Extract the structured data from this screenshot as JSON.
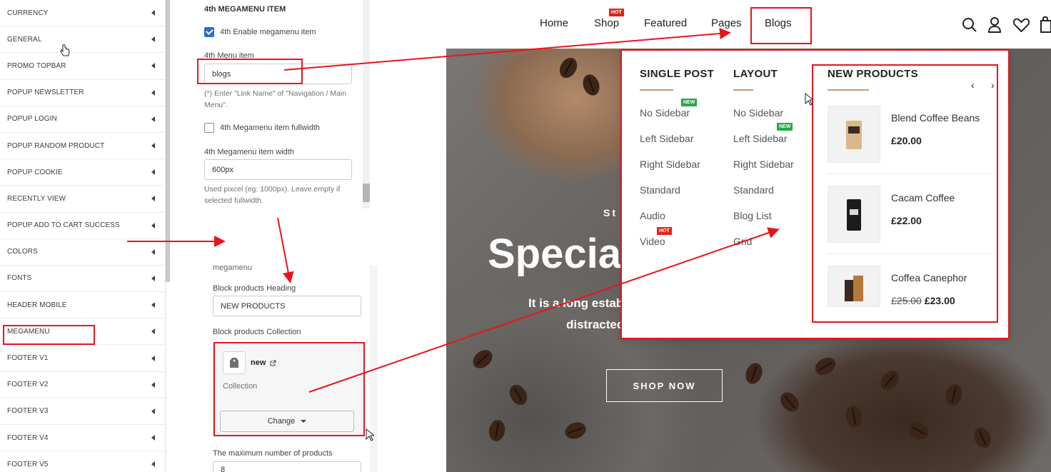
{
  "sidebar": {
    "items": [
      {
        "label": "CURRENCY"
      },
      {
        "label": "GENERAL"
      },
      {
        "label": "PROMO TOPBAR"
      },
      {
        "label": "POPUP NEWSLETTER"
      },
      {
        "label": "POPUP LOGIN"
      },
      {
        "label": "POPUP RANDOM PRODUCT"
      },
      {
        "label": "POPUP COOKIE"
      },
      {
        "label": "RECENTLY VIEW"
      },
      {
        "label": "POPUP ADD TO CART SUCCESS"
      },
      {
        "label": "COLORS"
      },
      {
        "label": "FONTS"
      },
      {
        "label": "HEADER MOBILE"
      },
      {
        "label": "MEGAMENU"
      },
      {
        "label": "FOOTER V1"
      },
      {
        "label": "FOOTER V2"
      },
      {
        "label": "FOOTER V3"
      },
      {
        "label": "FOOTER V4"
      },
      {
        "label": "FOOTER V5"
      }
    ]
  },
  "settings_top": {
    "title": "4th MEGAMENU ITEM",
    "enable_label": "4th Enable megamenu item",
    "enable_checked": true,
    "menu_item_label": "4th Menu item",
    "menu_item_value": "blogs",
    "menu_item_help": "(*) Enter \"Link Name\" of \"Navigation / Main Menu\".",
    "fullwidth_label": "4th Megamenu item fullwidth",
    "fullwidth_checked": false,
    "width_label": "4th Megamenu item width",
    "width_value": "600px",
    "width_help": "Used pixcel (eg: 1000px). Leave empty if selected fullwidth."
  },
  "settings_bottom": {
    "partial_text": "megamenu",
    "heading_label": "Block products Heading",
    "heading_value": "NEW PRODUCTS",
    "collection_label": "Block products Collection",
    "collection_name": "new",
    "collection_type": "Collection",
    "change_label": "Change",
    "max_label": "The maximum number of products",
    "max_value": "8"
  },
  "store": {
    "nav": [
      "Home",
      "Shop",
      "Featured",
      "Pages",
      "Blogs"
    ],
    "hot_badge": "HOT",
    "new_badge": "NEW",
    "hero_sub": "St",
    "hero_title": "Special",
    "hero_text1": "It is a long estab",
    "hero_text2": "distracted",
    "shop_now": "SHOP NOW"
  },
  "mega": {
    "col1": {
      "heading": "SINGLE POST",
      "links": [
        "No Sidebar",
        "Left Sidebar",
        "Right Sidebar",
        "Standard",
        "Audio",
        "Video"
      ]
    },
    "col2": {
      "heading": "LAYOUT",
      "links": [
        "No Sidebar",
        "Left Sidebar",
        "Right Sidebar",
        "Standard",
        "Blog List",
        "Grid"
      ]
    },
    "products": {
      "heading": "NEW PRODUCTS",
      "items": [
        {
          "name": "Blend Coffee Beans",
          "price": "£20.00",
          "old_price": ""
        },
        {
          "name": "Cacam Coffee",
          "price": "£22.00",
          "old_price": ""
        },
        {
          "name": "Coffea Canephor",
          "price": "£23.00",
          "old_price": "£25.00"
        }
      ]
    }
  },
  "colors": {
    "annotation": "#e8141c",
    "hot": "#e2231a",
    "new": "#27a844",
    "accent_line": "#c59b72",
    "checkbox": "#2c6ecb"
  }
}
